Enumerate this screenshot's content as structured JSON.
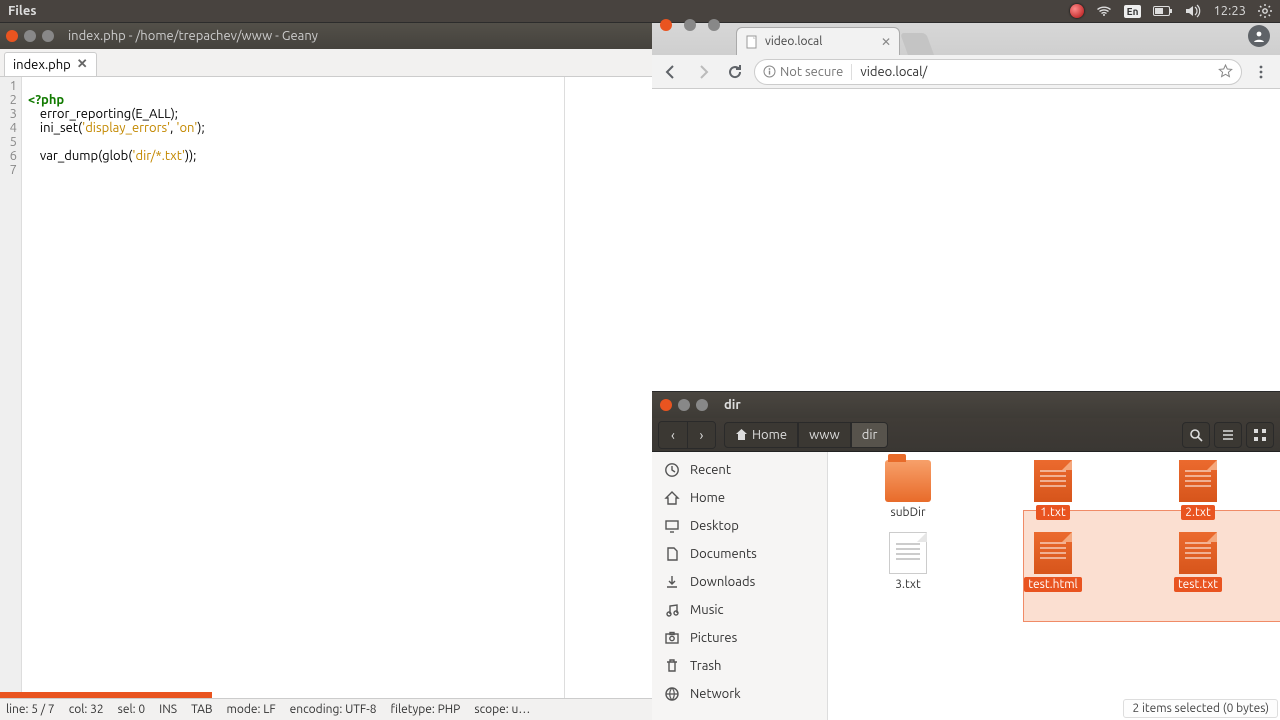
{
  "menubar": {
    "app": "Files",
    "lang": "En",
    "time": "12:23"
  },
  "geany": {
    "title": "index.php - /home/trepachev/www - Geany",
    "tab": "index.php",
    "lines": [
      "1",
      "2",
      "3",
      "4",
      "5",
      "6",
      "7"
    ],
    "code": {
      "l1a": "<?php",
      "l2a": "    error_reporting(E_ALL);",
      "l3a": "    ini_set(",
      "l3s1": "'display_errors'",
      "l3b": ", ",
      "l3s2": "'on'",
      "l3c": ");",
      "l5a": "    var_dump(glob(",
      "l5s1": "'dir/*.txt'",
      "l5b": "));"
    },
    "status": {
      "line": "line: 5 / 7",
      "col": "col: 32",
      "sel": "sel: 0",
      "ins": "INS",
      "tab": "TAB",
      "mode": "mode: LF",
      "enc": "encoding: UTF-8",
      "ft": "filetype: PHP",
      "scope": "scope: u…"
    }
  },
  "chrome": {
    "tab_title": "video.local",
    "not_secure": "Not secure",
    "url": "video.local/"
  },
  "nautilus": {
    "title": "dir",
    "path": {
      "home": "Home",
      "p1": "www",
      "p2": "dir"
    },
    "sidebar": {
      "recent": "Recent",
      "home": "Home",
      "desktop": "Desktop",
      "documents": "Documents",
      "downloads": "Downloads",
      "music": "Music",
      "pictures": "Pictures",
      "trash": "Trash",
      "network": "Network"
    },
    "files": {
      "subdir": "subDir",
      "f1": "1.txt",
      "f2": "2.txt",
      "f3": "3.txt",
      "fh": "test.html",
      "ft": "test.txt"
    },
    "status": "2 items selected  (0 bytes)"
  }
}
